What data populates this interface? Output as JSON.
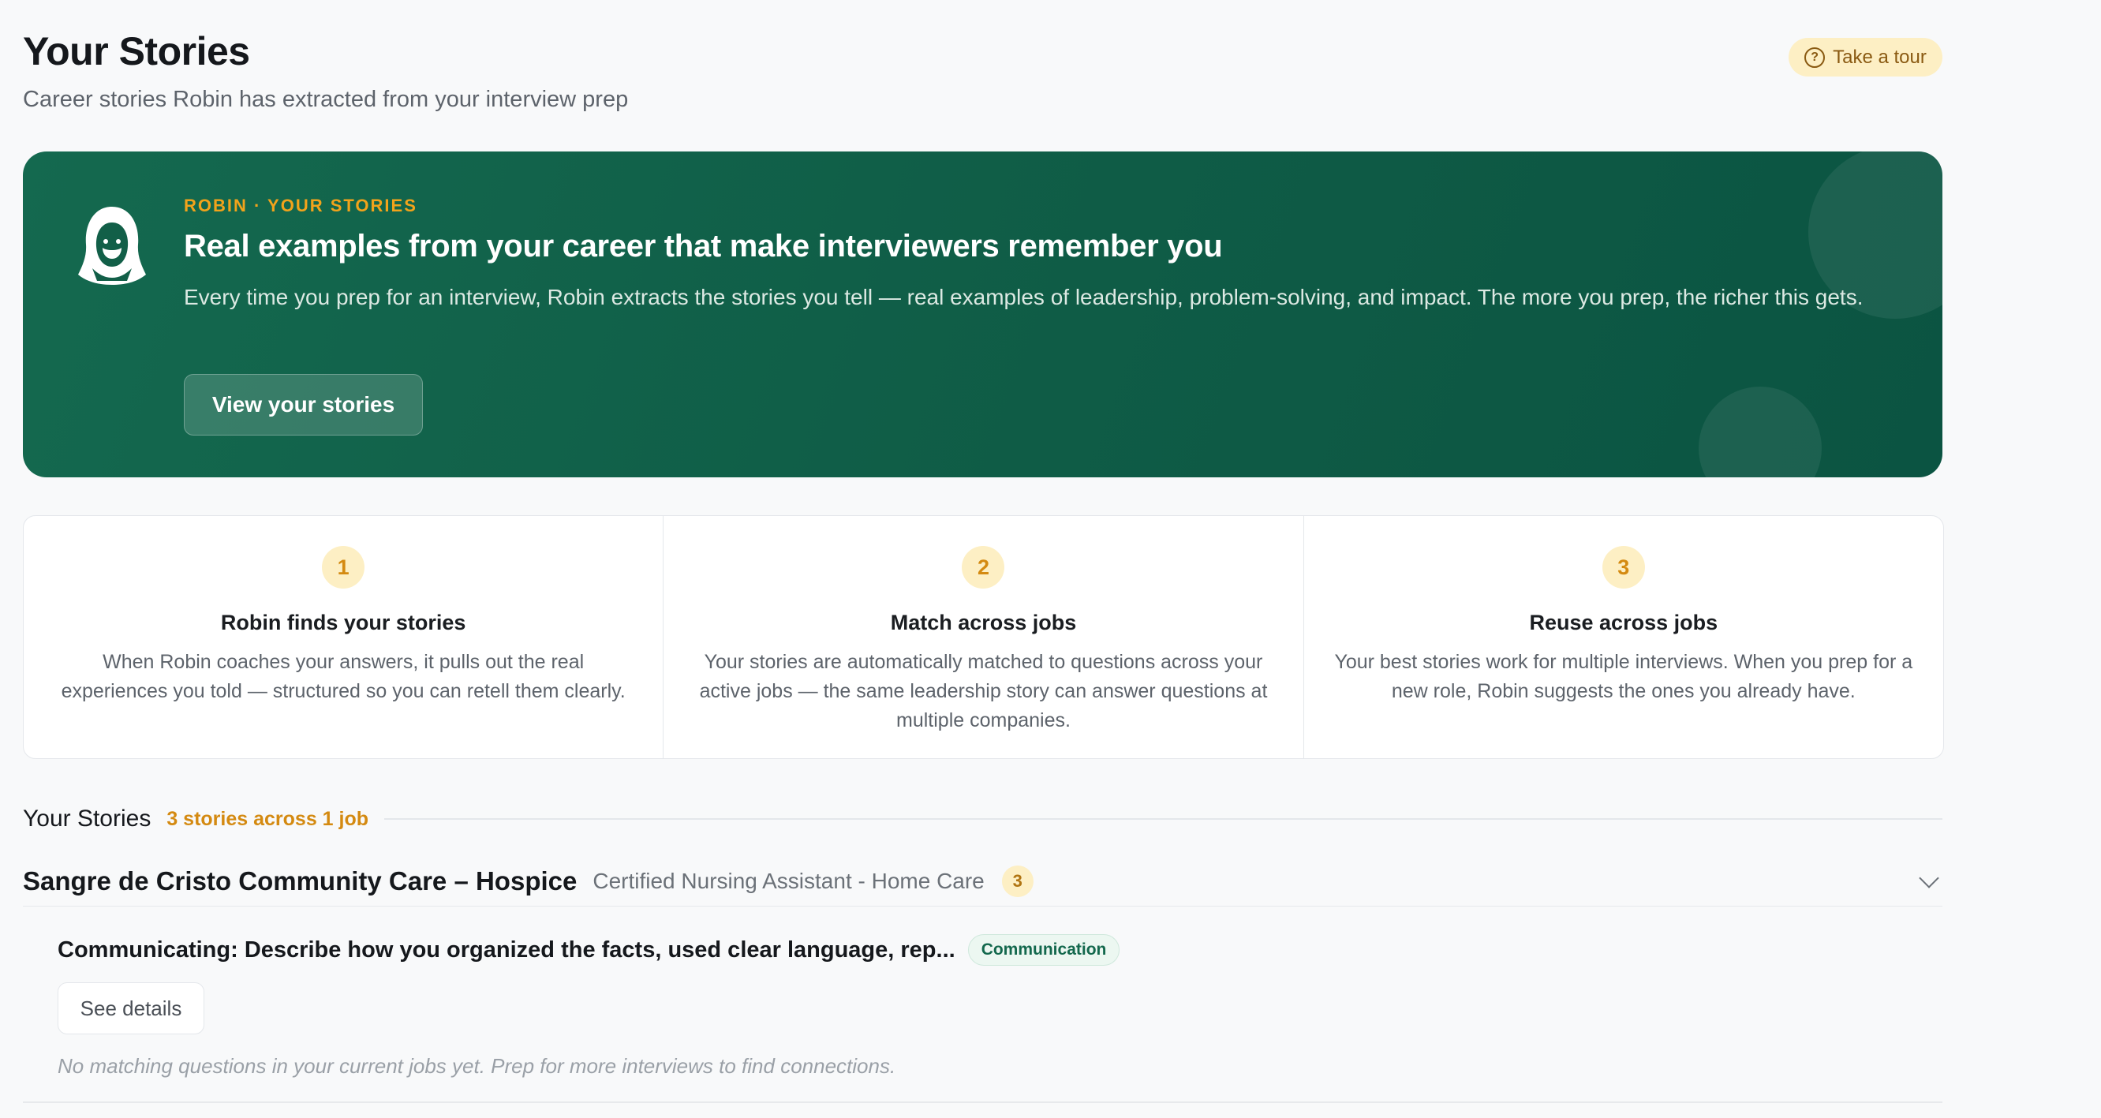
{
  "header": {
    "title": "Your Stories",
    "subtitle": "Career stories Robin has extracted from your interview prep",
    "tour_label": "Take a tour",
    "tour_icon": "question-circle-icon"
  },
  "hero": {
    "eyebrow": "ROBIN · YOUR STORIES",
    "title": "Real examples from your career that make interviewers remember you",
    "body": "Every time you prep for an interview, Robin extracts the stories you tell — real examples of leadership, problem-solving, and impact. The more you prep, the richer this gets.",
    "button_label": "View your stories",
    "logo_icon": "hooded-robin-icon",
    "colors": {
      "background": "#0f5c46",
      "eyebrow": "#f2a31b"
    }
  },
  "steps": [
    {
      "number": "1",
      "title": "Robin finds your stories",
      "description": "When Robin coaches your answers, it pulls out the real experiences you told — structured so you can retell them clearly."
    },
    {
      "number": "2",
      "title": "Match across jobs",
      "description": "Your stories are automatically matched to questions across your active jobs — the same leadership story can answer questions at multiple companies."
    },
    {
      "number": "3",
      "title": "Reuse across jobs",
      "description": "Your best stories work for multiple interviews. When you prep for a new role, Robin suggests the ones you already have."
    }
  ],
  "stories_section": {
    "title": "Your Stories",
    "count_label": "3 stories across 1 job",
    "company": {
      "name": "Sangre de Cristo Community Care – Hospice",
      "role": "Certified Nursing Assistant - Home Care",
      "story_count": "3",
      "expand_icon": "chevron-down-icon"
    },
    "story": {
      "question": "Communicating: Describe how you organized the facts, used clear language, rep...",
      "tag": "Communication",
      "details_label": "See details",
      "empty_note": "No matching questions in your current jobs yet. Prep for more interviews to find connections."
    }
  }
}
